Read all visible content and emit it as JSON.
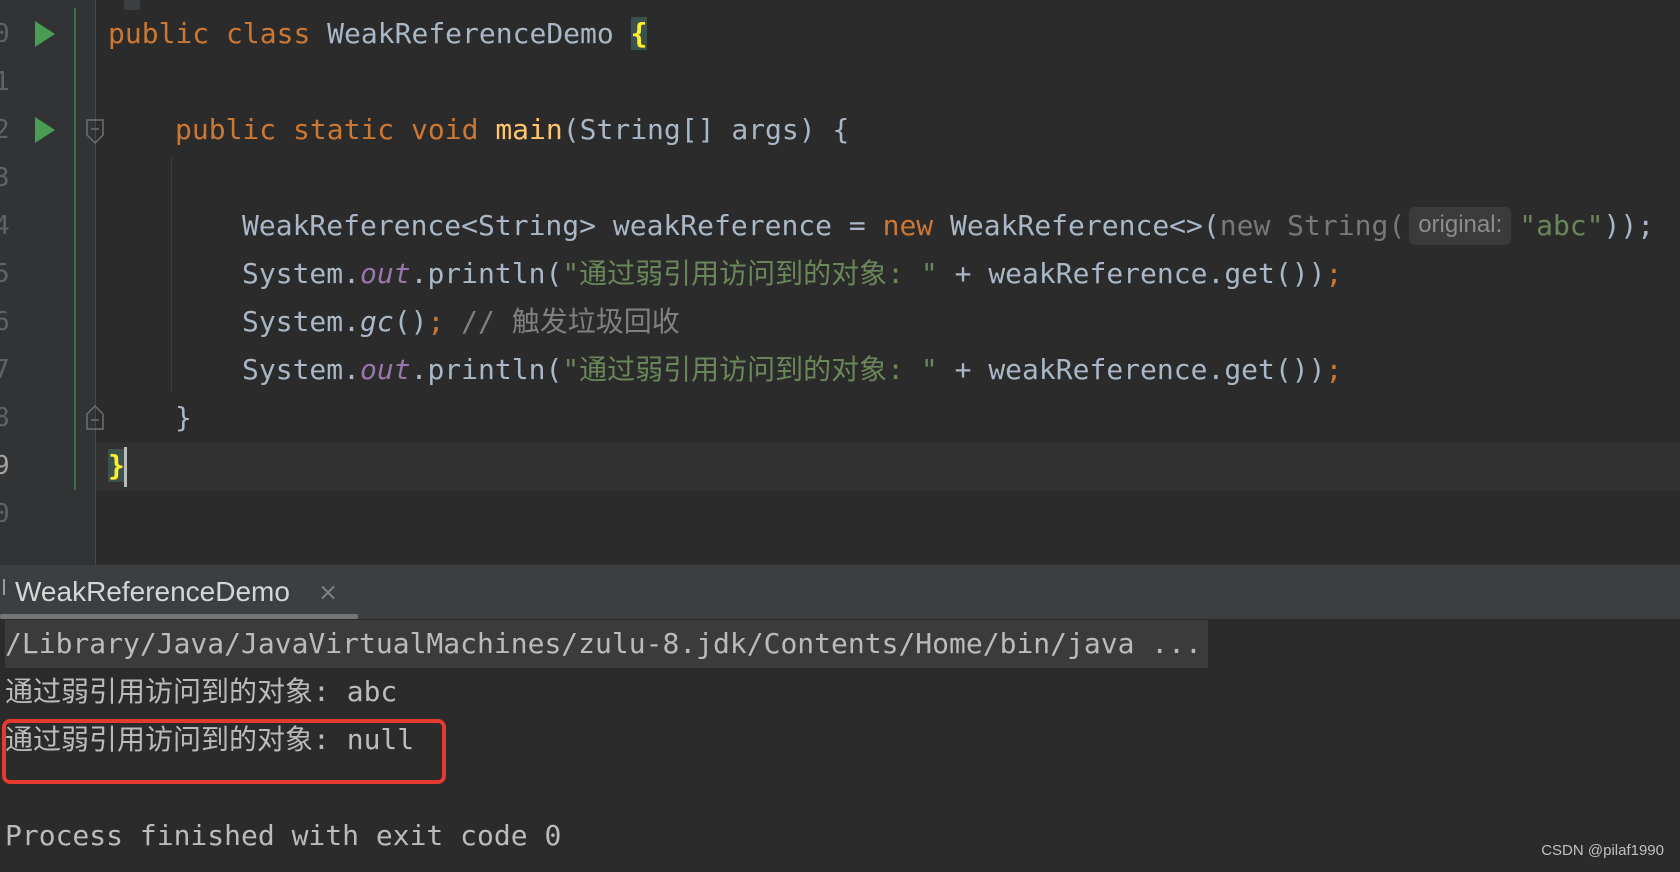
{
  "editor": {
    "line_numbers": [
      "0",
      "1",
      "2",
      "3",
      "4",
      "5",
      "6",
      "7",
      "8",
      "9",
      "0"
    ],
    "lines": {
      "l0": {
        "kw1": "public",
        "kw2": "class",
        "name": "WeakReferenceDemo",
        "brace": "{"
      },
      "l2": {
        "kw1": "public",
        "kw2": "static",
        "kw3": "void",
        "fn": "main",
        "params": "(String[] args) {"
      },
      "l4": {
        "decl": "WeakReference<String> weakReference = ",
        "kw_new": "new",
        "ctor": " WeakReference<>(",
        "inner_new": "new String(",
        "hint": "original:",
        "str": "\"abc\"",
        "close": "));",
        "semi": ";"
      },
      "l5": {
        "prefix": "System.",
        "field": "out",
        "call": ".println(",
        "str": "\"通过弱引用访问到的对象: \"",
        "rest": " + weakReference.get())",
        "semi": ";"
      },
      "l6": {
        "prefix": "System.",
        "method": "gc",
        "call": "()",
        "semi": ";",
        "comment": " // 触发垃圾回收"
      },
      "l7": {
        "prefix": "System.",
        "field": "out",
        "call": ".println(",
        "str": "\"通过弱引用访问到的对象: \"",
        "rest": " + weakReference.get())",
        "semi": ";"
      },
      "l8": {
        "brace": "}"
      },
      "l9": {
        "brace": "}"
      }
    }
  },
  "run_panel": {
    "tab_label": "WeakReferenceDemo",
    "tab_close": "×",
    "console": [
      "/Library/Java/JavaVirtualMachines/zulu-8.jdk/Contents/Home/bin/java ...",
      "通过弱引用访问到的对象: abc",
      "通过弱引用访问到的对象: null",
      "",
      "Process finished with exit code 0"
    ]
  },
  "watermark": "CSDN @pilaf1990",
  "colors": {
    "background": "#2b2b2b",
    "keyword": "#cc7832",
    "function": "#ffc66d",
    "string": "#6a8759",
    "field": "#9876aa",
    "text": "#a9b7c6",
    "highlight_box": "#e53a2f"
  }
}
